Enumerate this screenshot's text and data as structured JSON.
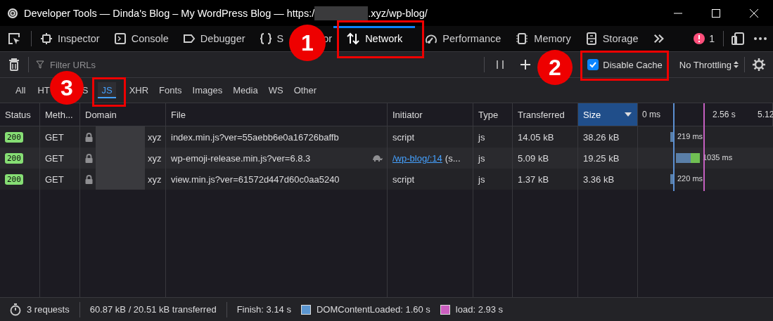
{
  "window": {
    "title_start": "Developer Tools — Dinda's Blog – My WordPress Blog — https:/",
    "title_end": ".xyz/wp-blog/"
  },
  "tools": [
    {
      "kind": "inspector",
      "label": "Inspector",
      "selected": false
    },
    {
      "kind": "console",
      "label": "Console",
      "selected": false
    },
    {
      "kind": "debugger",
      "label": "Debugger",
      "selected": false
    },
    {
      "kind": "style",
      "label": "S",
      "label_end": "or",
      "selected": false
    },
    {
      "kind": "network",
      "label": "Network",
      "selected": true
    },
    {
      "kind": "performance",
      "label": "Performance",
      "selected": false
    },
    {
      "kind": "memory",
      "label": "Memory",
      "selected": false
    },
    {
      "kind": "storage",
      "label": "Storage",
      "selected": false
    }
  ],
  "error_count": "1",
  "filter": {
    "placeholder": "Filter URLs"
  },
  "disable_cache": {
    "label": "Disable Cache",
    "checked": true
  },
  "throttling": "No Throttling",
  "type_filters": [
    {
      "label": "All",
      "selected": false
    },
    {
      "label": "HT",
      "selected": false
    },
    {
      "label": "S",
      "selected": false
    },
    {
      "label": "JS",
      "selected": true
    },
    {
      "label": "XHR",
      "selected": false
    },
    {
      "label": "Fonts",
      "selected": false
    },
    {
      "label": "Images",
      "selected": false
    },
    {
      "label": "Media",
      "selected": false
    },
    {
      "label": "WS",
      "selected": false
    },
    {
      "label": "Other",
      "selected": false
    }
  ],
  "table": {
    "columns": [
      {
        "label": "Status",
        "sorted": false
      },
      {
        "label": "Meth...",
        "sorted": false
      },
      {
        "label": "Domain",
        "sorted": false
      },
      {
        "label": "File",
        "sorted": false
      },
      {
        "label": "Initiator",
        "sorted": false
      },
      {
        "label": "Type",
        "sorted": false
      },
      {
        "label": "Transferred",
        "sorted": false
      },
      {
        "label": "Size",
        "sorted": true
      }
    ],
    "timeline_ticks": [
      "0 ms",
      "2.56 s",
      "5.12"
    ],
    "rows": [
      {
        "status": "200",
        "method": "GET",
        "domain": "xyz",
        "file": "index.min.js?ver=55aebb6e0a16726baffb",
        "slow": false,
        "initiator": "script",
        "initiator_link": "",
        "initiator_rest": "",
        "type": "js",
        "transferred": "14.05 kB",
        "size": "38.26 kB",
        "timing": "219 ms"
      },
      {
        "status": "200",
        "method": "GET",
        "domain": "xyz",
        "file": "wp-emoji-release.min.js?ver=6.8.3",
        "slow": true,
        "initiator": "",
        "initiator_link": "/wp-blog/:14",
        "initiator_rest": "(s...",
        "type": "js",
        "transferred": "5.09 kB",
        "size": "19.25 kB",
        "timing": "1035 ms"
      },
      {
        "status": "200",
        "method": "GET",
        "domain": "xyz",
        "file": "view.min.js?ver=61572d447d60c0aa5240",
        "slow": false,
        "initiator": "script",
        "initiator_link": "",
        "initiator_rest": "",
        "type": "js",
        "transferred": "1.37 kB",
        "size": "3.36 kB",
        "timing": "220 ms"
      }
    ]
  },
  "status_bar": {
    "requests": "3 requests",
    "transferred": "60.87 kB / 20.51 kB transferred",
    "finish": "Finish: 3.14 s",
    "dom_content_loaded": "DOMContentLoaded: 1.60 s",
    "load": "load: 2.93 s"
  },
  "callouts": [
    "1",
    "2",
    "3"
  ]
}
